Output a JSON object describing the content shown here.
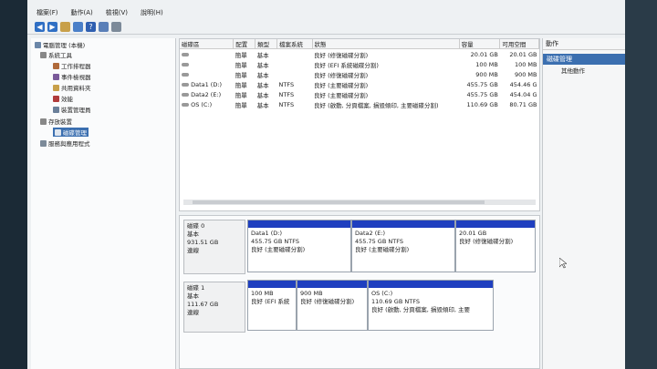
{
  "menu": [
    "檔案(F)",
    "動作(A)",
    "檢視(V)",
    "說明(H)"
  ],
  "tree": {
    "root": "電腦管理 (本機)",
    "system_tools": "系統工具",
    "task_scheduler": "工作排程器",
    "event_viewer": "事件檢視器",
    "shared_folders": "共用資料夾",
    "performance": "效能",
    "device_manager": "裝置管理員",
    "storage": "存放裝置",
    "disk_management": "磁碟管理",
    "services": "服務與應用程式"
  },
  "volumes": {
    "headers": [
      "磁碟區",
      "配置",
      "類型",
      "檔案系統",
      "狀態",
      "容量",
      "可用空間"
    ],
    "rows": [
      [
        "",
        "簡單",
        "基本",
        "",
        "良好 (修復磁碟分割)",
        "20.01 GB",
        "20.01 GB"
      ],
      [
        "",
        "簡單",
        "基本",
        "",
        "良好 (EFI 系統磁碟分割)",
        "100 MB",
        "100 MB"
      ],
      [
        "",
        "簡單",
        "基本",
        "",
        "良好 (修復磁碟分割)",
        "900 MB",
        "900 MB"
      ],
      [
        "Data1 (D:)",
        "簡單",
        "基本",
        "NTFS",
        "良好 (主要磁碟分割)",
        "455.75 GB",
        "454.46 G"
      ],
      [
        "Data2 (E:)",
        "簡單",
        "基本",
        "NTFS",
        "良好 (主要磁碟分割)",
        "455.75 GB",
        "454.04 G"
      ],
      [
        "OS (C:)",
        "簡單",
        "基本",
        "NTFS",
        "良好 (啟動, 分頁檔案, 損毀傾印, 主要磁碟分割)",
        "110.69 GB",
        "80.71 GB"
      ]
    ]
  },
  "disk0": {
    "name": "磁碟 0",
    "type": "基本",
    "size": "931.51 GB",
    "status": "連線",
    "partitions": [
      {
        "l1": "Data1 (D:)",
        "l2": "455.75 GB NTFS",
        "l3": "良好 (主要磁碟分割)"
      },
      {
        "l1": "Data2 (E:)",
        "l2": "455.75 GB NTFS",
        "l3": "良好 (主要磁碟分割)"
      },
      {
        "l1": "",
        "l2": "20.01 GB",
        "l3": "良好 (修復磁碟分割)"
      }
    ]
  },
  "disk1": {
    "name": "磁碟 1",
    "type": "基本",
    "size": "111.67 GB",
    "status": "連線",
    "partitions": [
      {
        "l1": "",
        "l2": "100 MB",
        "l3": "良好 (EFI 系統"
      },
      {
        "l1": "",
        "l2": "900 MB",
        "l3": "良好 (修復磁碟分割)"
      },
      {
        "l1": "OS (C:)",
        "l2": "110.69 GB NTFS",
        "l3": "良好 (啟動, 分頁檔案, 損毀傾印, 主要"
      }
    ]
  },
  "actions": {
    "title": "動作",
    "section": "磁碟管理",
    "more": "其他動作"
  },
  "colors": {
    "partition_bar": "#1f3fbf",
    "selection": "#3b6fb0"
  }
}
